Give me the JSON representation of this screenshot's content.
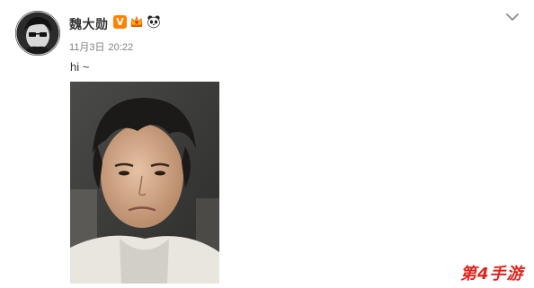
{
  "post": {
    "username": "魏大勋",
    "verified_badge": "V",
    "date": "11月3日",
    "time": "20:22",
    "text": "hi ~",
    "menu_icon": "chevron-down-icon",
    "photo_icon": "selfie-photo"
  },
  "watermark": {
    "text": "第4手游"
  },
  "colors": {
    "username": "#333333",
    "meta": "#808080",
    "verified": "#ff8200",
    "watermark": "#e2231a"
  }
}
